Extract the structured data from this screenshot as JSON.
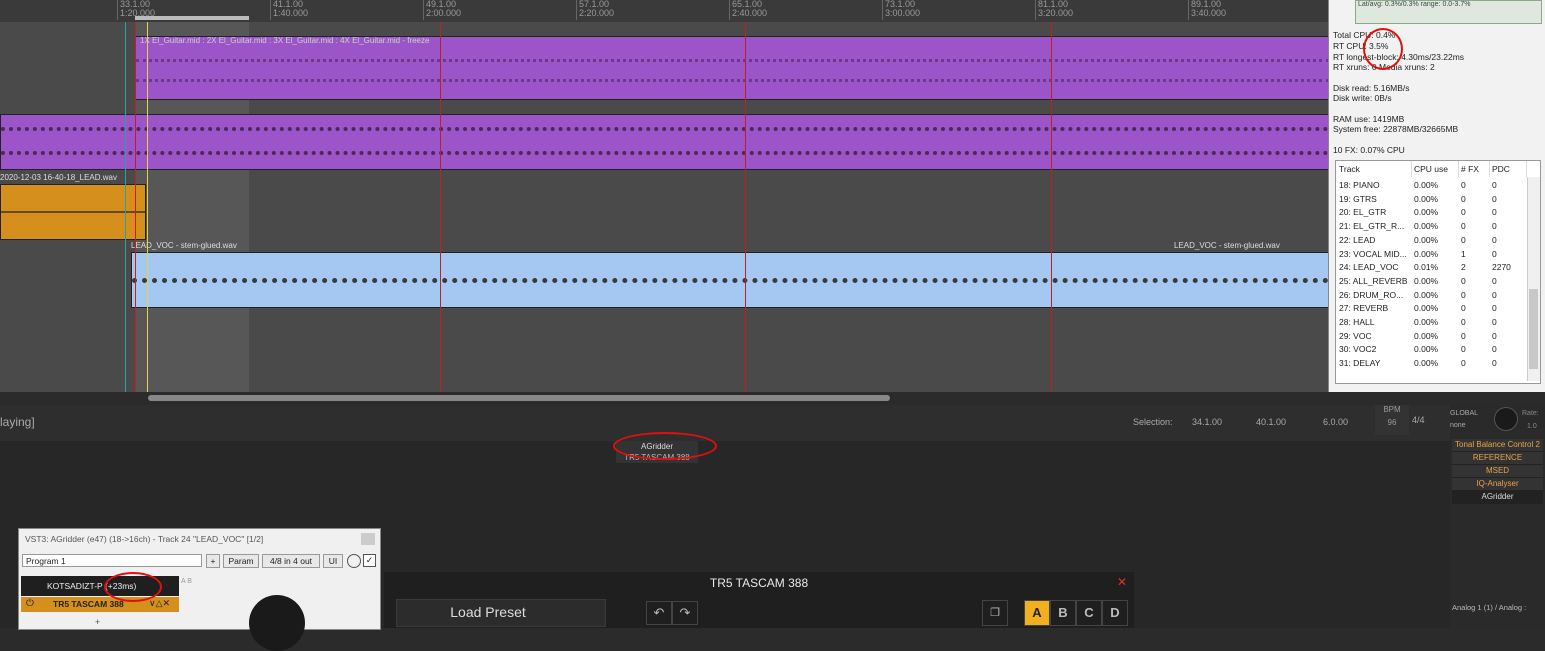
{
  "ruler": {
    "marks": [
      "33.1.00",
      "41.1.00",
      "49.1.00",
      "57.1.00",
      "65.1.00",
      "73.1.00",
      "81.1.00",
      "89.1.00"
    ],
    "times": [
      "1:20.000",
      "1:40.000",
      "2:00.000",
      "2:20.000",
      "2:40.000",
      "3:00.000",
      "3:20.000",
      "3:40.000"
    ]
  },
  "items": {
    "freeze_label": "1X El_Guitar.mid : 2X El_Guitar.mid : 3X El_Guitar.mid : 4X El_Guitar.mid - freeze",
    "lead_label": "2020-12-03 16-40-18_LEAD.wav",
    "voc_label_1": "LEAD_VOC - stem-glued.wav",
    "voc_label_2": "LEAD_VOC - stem-glued.wav"
  },
  "perf": {
    "top_line": "Lat/avg: 0.3%/0.3%  range: 0.0-3.7%",
    "total_cpu": "Total CPU: 0.4%",
    "rt_cpu": "RT CPU: 3.5%",
    "rt_longest": "RT longest-block: 4.30ms/23.22ms",
    "rt_xruns": "RT xruns: 0   Media xruns: 2",
    "disk_read": "Disk read: 5.16MB/s",
    "disk_write": "Disk write: 0B/s",
    "ram_use": "RAM use: 1419MB",
    "system_free": "System free: 22878MB/32665MB",
    "fx_cpu": "10 FX: 0.07% CPU",
    "headers": [
      "Track",
      "CPU use",
      "# FX",
      "PDC"
    ],
    "rows": [
      [
        "18: PIANO",
        "0.00%",
        "0",
        "0"
      ],
      [
        "19: GTRS",
        "0.00%",
        "0",
        "0"
      ],
      [
        "20: EL_GTR",
        "0.00%",
        "0",
        "0"
      ],
      [
        "21: EL_GTR_R...",
        "0.00%",
        "0",
        "0"
      ],
      [
        "22: LEAD",
        "0.00%",
        "0",
        "0"
      ],
      [
        "23: VOCAL MID...",
        "0.00%",
        "1",
        "0"
      ],
      [
        "24: LEAD_VOC",
        "0.01%",
        "2",
        "2270"
      ],
      [
        "25: ALL_REVERB",
        "0.00%",
        "0",
        "0"
      ],
      [
        "26: DRUM_RO...",
        "0.00%",
        "0",
        "0"
      ],
      [
        "27: REVERB",
        "0.00%",
        "0",
        "0"
      ],
      [
        "28: HALL",
        "0.00%",
        "0",
        "0"
      ],
      [
        "29: VOC",
        "0.00%",
        "0",
        "0"
      ],
      [
        "30: VOC2",
        "0.00%",
        "0",
        "0"
      ],
      [
        "31: DELAY",
        "0.00%",
        "0",
        "0"
      ]
    ]
  },
  "transport": {
    "status": "laying]",
    "selection_label": "Selection:",
    "sel_start": "34.1.00",
    "sel_end": "40.1.00",
    "sel_len": "6.0.00",
    "bpm_label": "BPM",
    "bpm": "96",
    "timesig": "4/4",
    "global_label": "GLOBAL",
    "global_val": "none",
    "rate_label": "Rate:",
    "rate_val": "1.0"
  },
  "mixer": {
    "agridder_label": "AGridder",
    "tr5_label": "TR5 TASCAM 388"
  },
  "fxlist": {
    "items": [
      "Tonal Balance Control 2",
      "REFERENCE",
      "MSED",
      "IQ-Analyser",
      "AGridder"
    ],
    "io": "Analog 1 (1) / Analog :"
  },
  "vst": {
    "title": "VST3: AGridder (e47) (18->16ch) - Track 24 \"LEAD_VOC\" [1/2]",
    "program": "Program 1",
    "plus": "+",
    "param": "Param",
    "io": "4/8 in 4 out",
    "ui": "UI",
    "host": "KOTSADIZT-P",
    "latency": "(+23ms)",
    "chain_item": "TR5 TASCAM 388",
    "ab": "A B",
    "add": "+"
  },
  "tr5": {
    "title": "TR5 TASCAM 388",
    "preset": "Load Preset",
    "slots": [
      "A",
      "B",
      "C",
      "D"
    ]
  },
  "colors": {
    "purple": "#9b55c9",
    "orange": "#d48f1c",
    "blue": "#a5c8f2",
    "red_annot": "#e01010",
    "cursor_red": "#c02020"
  }
}
